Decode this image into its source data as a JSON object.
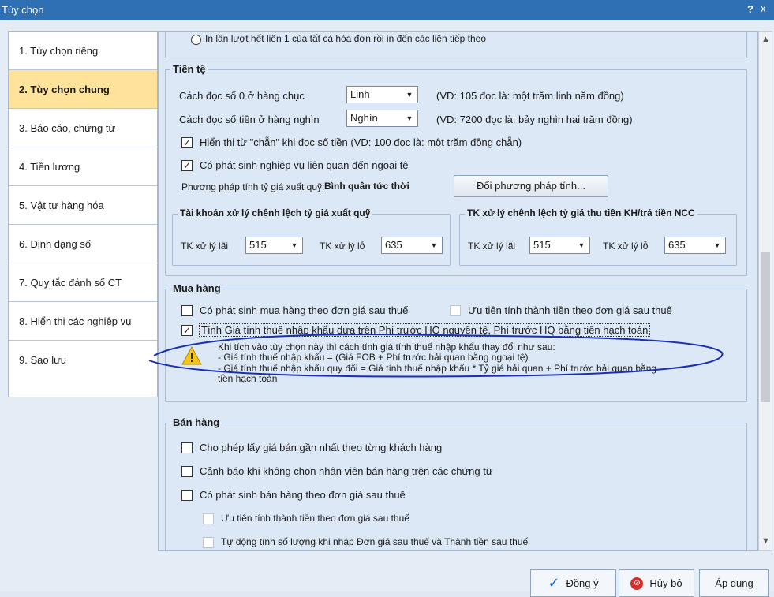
{
  "window": {
    "title": "Tùy chọn",
    "help_label": "?",
    "close_label": "x"
  },
  "sidebar": {
    "items": [
      {
        "label": "1. Tùy chọn riêng"
      },
      {
        "label": "2. Tùy chọn chung"
      },
      {
        "label": "3. Báo cáo, chứng từ"
      },
      {
        "label": "4. Tiền lương"
      },
      {
        "label": "5. Vật tư hàng hóa"
      },
      {
        "label": "6. Định dạng số"
      },
      {
        "label": "7. Quy tắc đánh số CT"
      },
      {
        "label": "8. Hiển thị các nghiệp vụ"
      },
      {
        "label": "9. Sao lưu"
      }
    ]
  },
  "top": {
    "radio_text": "In lần lượt hết liên 1 của tất cả hóa đơn rồi in đến các liên tiếp theo"
  },
  "tiente": {
    "title": "Tiền tệ",
    "row1_label": "Cách đọc số 0 ở hàng chục",
    "row1_value": "Linh",
    "row1_example": "(VD: 105 đọc là: một trăm linh năm đồng)",
    "row2_label": "Cách đọc số tiền ở hàng nghìn",
    "row2_value": "Nghìn",
    "row2_example": "(VD: 7200 đọc là: bảy nghìn hai trăm đồng)",
    "cb1_label": "Hiển thị từ \"chẵn\" khi đọc số tiền (VD: 100 đọc là: một trăm đồng chẵn)",
    "cb2_label": "Có phát sinh nghiệp vụ liên quan đến ngoại tệ",
    "method_label": "Phương pháp tính tỷ giá xuất quỹ:",
    "method_value": "Bình quân tức thời",
    "method_button": "Đổi phương pháp tính...",
    "sub1_title": "Tài khoản xử lý chênh lệch tỷ giá xuất quỹ",
    "sub2_title": "TK xử lý chênh lệch tỷ giá thu tiền KH/trả tiền NCC",
    "lai_label": "TK xử lý lãi",
    "lo_label": "TK xử lý lỗ",
    "sub1_lai": "515",
    "sub1_lo": "635",
    "sub2_lai": "515",
    "sub2_lo": "635"
  },
  "muahang": {
    "title": "Mua hàng",
    "cb1_label": "Có phát sinh mua hàng theo đơn giá sau thuế",
    "cb2_label": "Ưu tiên tính thành tiền theo đơn giá sau thuế",
    "cb3_label": "Tính Giá tính thuế nhập khẩu dựa trên Phí trước HQ nguyên tệ, Phí trước HQ bằng tiền hạch toán",
    "note1": "Khi tích vào tùy chọn này thì cách tính giá tính thuế nhập khẩu thay đổi như sau:",
    "note2": "- Giá tính thuế nhập khẩu = (Giá FOB + Phí trước hải quan bằng ngoại tệ)",
    "note3": "- Giá tính thuế nhập khẩu quy đổi = Giá tính thuế nhập khẩu * Tỷ giá hải quan + Phí trước hải quan bằng",
    "note4": "tiền hạch toán"
  },
  "banhang": {
    "title": "Bán hàng",
    "cb1_label": "Cho phép lấy giá bán gần nhất theo từng khách hàng",
    "cb2_label": "Cảnh báo khi không chọn nhân viên bán hàng trên các chứng từ",
    "cb3_label": "Có phát sinh bán hàng theo đơn giá sau thuế",
    "cb4_label": "Ưu tiên tính thành tiền theo đơn giá sau thuế",
    "cb5_label": "Tự động tính số lượng khi nhập Đơn giá sau thuế và Thành tiền sau thuế"
  },
  "footer": {
    "ok": "Đồng ý",
    "cancel": "Hủy bỏ",
    "apply": "Áp dụng"
  },
  "colors": {
    "titlebar": "#2f6fb3",
    "active_item": "#ffe39b",
    "annotation": "#1a2fb8"
  },
  "icons": [
    "check-icon",
    "cancel-icon",
    "warning-icon",
    "scroll-up-icon",
    "scroll-down-icon",
    "dropdown-arrow-icon"
  ]
}
